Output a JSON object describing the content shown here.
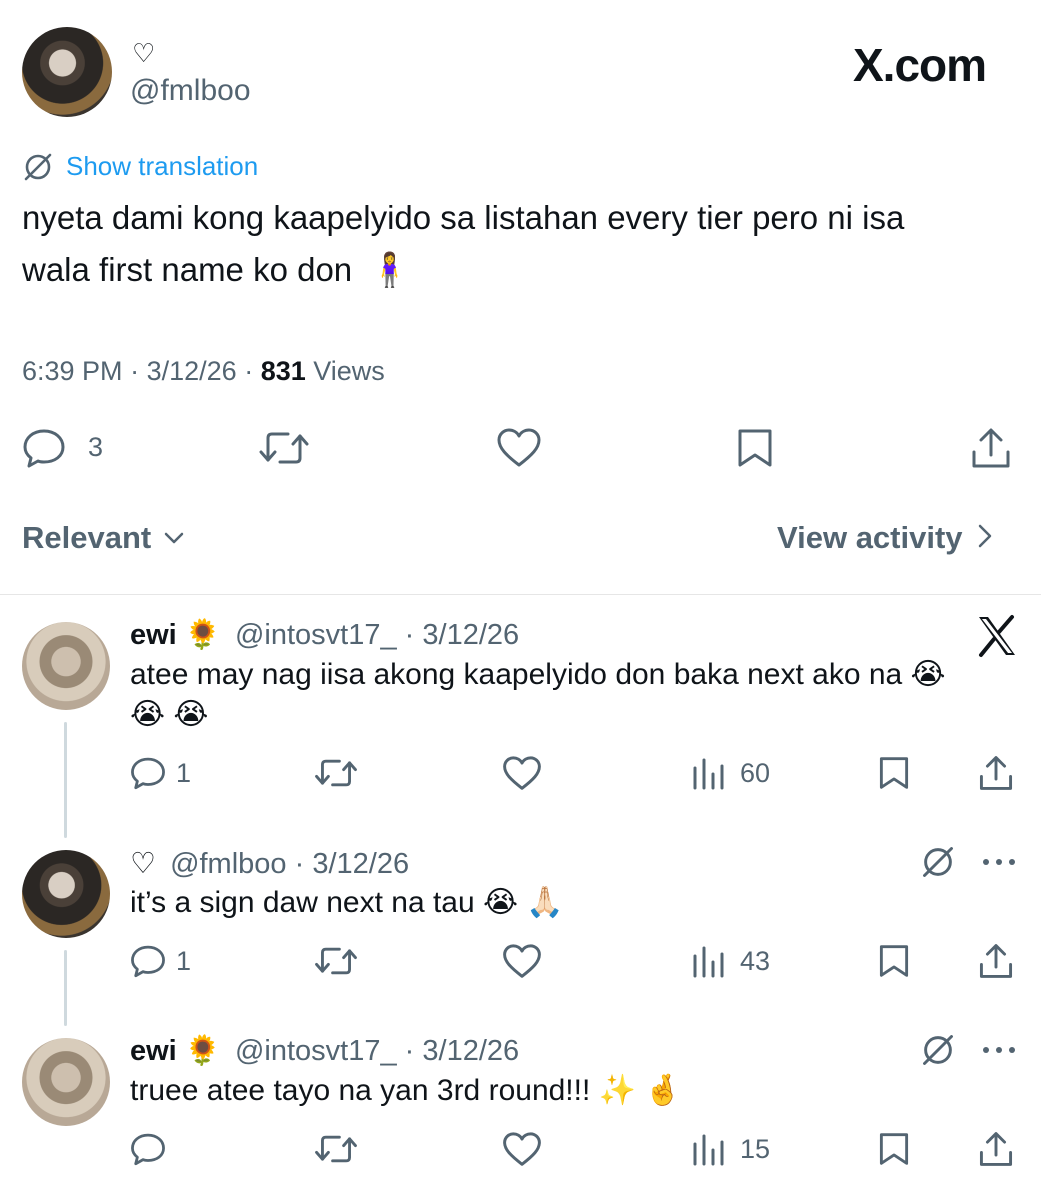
{
  "brand": {
    "logo_text": "X.com"
  },
  "tweet": {
    "heart_symbol": "♡",
    "handle": "@fmlboo",
    "translate_label": "Show translation",
    "text_line1": "nyeta dami kong kaapelyido sa listahan every tier pero ni isa",
    "text_line2": "wala first name ko don",
    "emoji": "🧍‍♀️",
    "time": "6:39 PM",
    "date": "3/12/26",
    "views_count": "831",
    "views_label": "Views",
    "reply_count": "3"
  },
  "sort": {
    "relevant_label": "Relevant",
    "view_activity_label": "View activity"
  },
  "replies": [
    {
      "name": "ewi",
      "name_emoji": "🌻",
      "handle_date": "@intosvt17_ · 3/12/26",
      "text_line1": "atee may nag iisa akong kaapelyido don baka next ako na 😭",
      "text_line2": "😭 😭",
      "reply_count": "1",
      "views": "60"
    },
    {
      "heart_symbol": "♡",
      "handle_date": "@fmlboo · 3/12/26",
      "text_line1": "it’s a sign daw next na tau 😭 🙏🏻",
      "reply_count": "1",
      "views": "43"
    },
    {
      "name": "ewi",
      "name_emoji": "🌻",
      "handle_date": "@intosvt17_ · 3/12/26",
      "text_line1": "truee atee tayo na yan 3rd round!!! ✨ 🤞",
      "reply_count": "",
      "views": "15"
    }
  ]
}
